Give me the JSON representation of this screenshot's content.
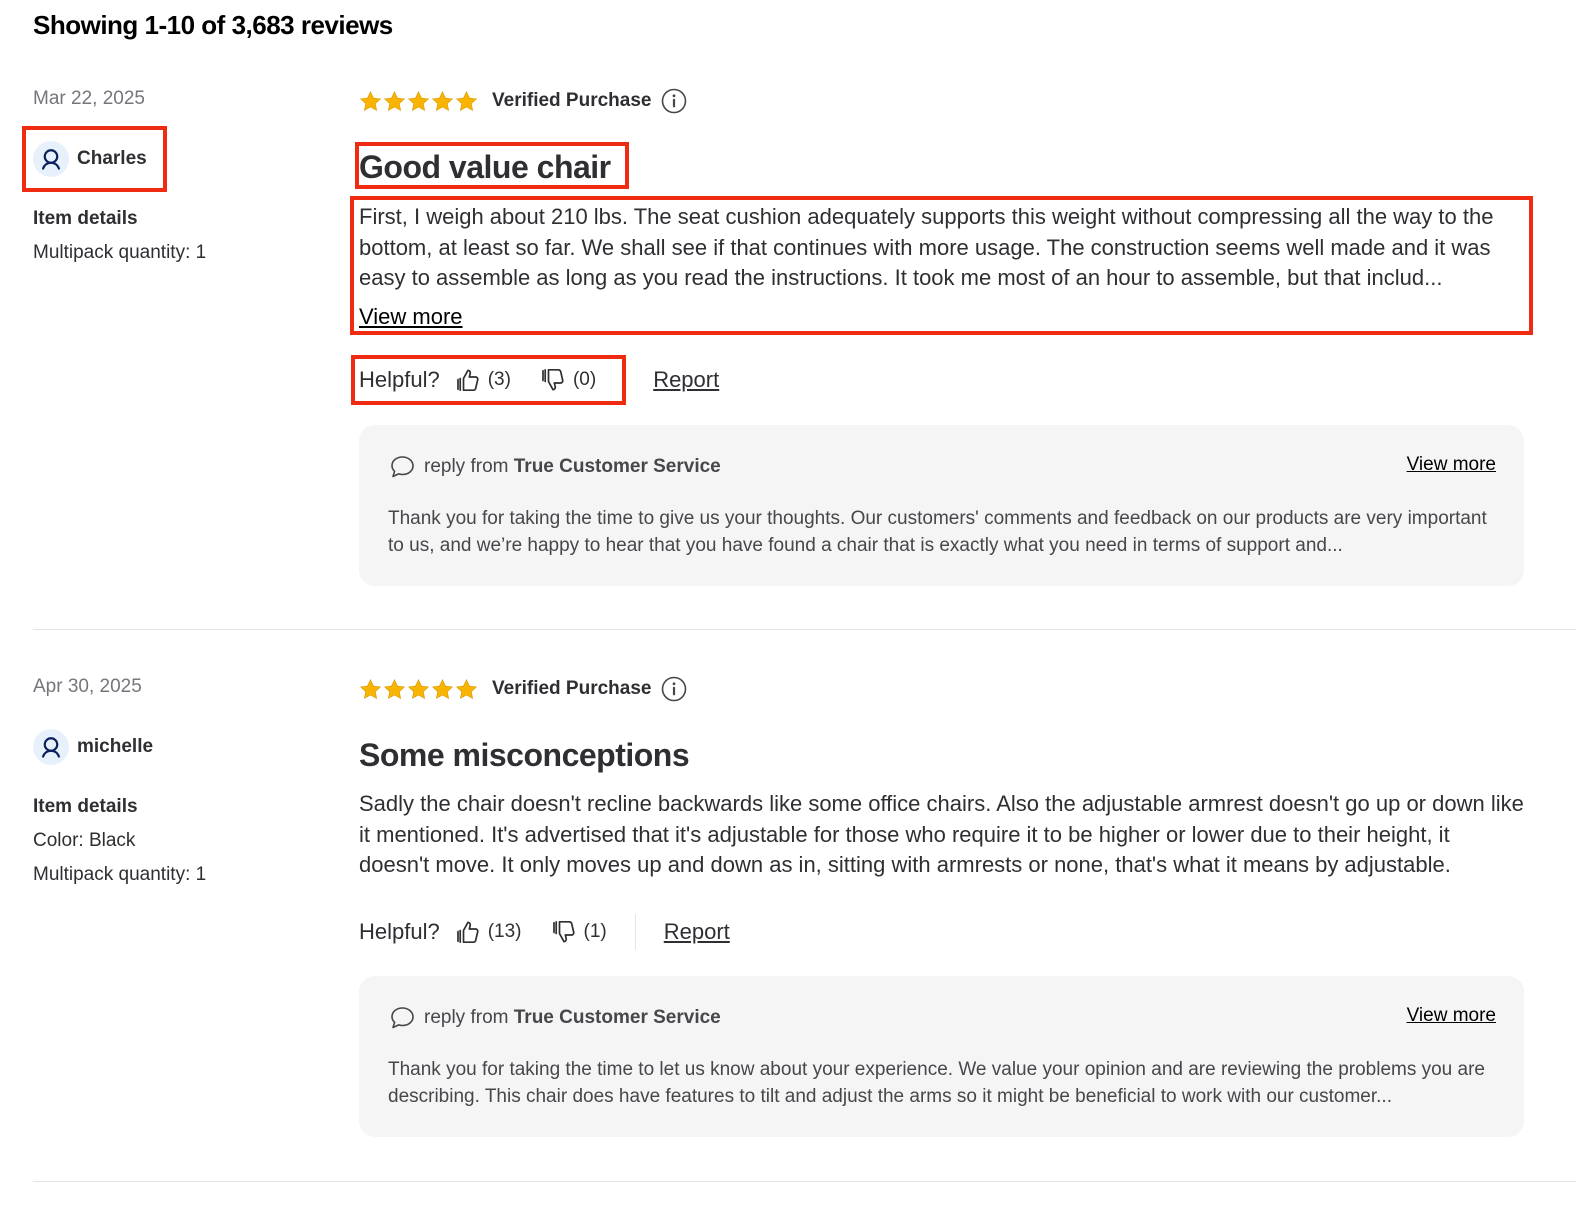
{
  "header": {
    "showing_text": "Showing 1-10 of 3,683 reviews"
  },
  "colors": {
    "star": "#f8b400",
    "highlight": "#ef2b12",
    "reply_bg": "#f5f5f6",
    "avatar_bg": "#e6f1fc",
    "avatar_icon": "#0d1f5c"
  },
  "labels": {
    "verified": "Verified Purchase",
    "item_details": "Item details",
    "helpful": "Helpful?",
    "report": "Report",
    "view_more": "View more",
    "reply_from": "reply from",
    "icons": [
      "star-icon",
      "info-icon",
      "user-icon",
      "thumbs-up-icon",
      "thumbs-down-icon",
      "comment-icon"
    ]
  },
  "reviews": [
    {
      "date": "Mar 22, 2025",
      "user": "Charles",
      "rating": 5,
      "details": [
        "Multipack quantity: 1"
      ],
      "title": "Good value chair",
      "body": "First, I weigh about 210 lbs. The seat cushion adequately supports this weight without compressing all the way to the bottom, at least so far. We shall see if that continues with more usage. The construction seems well made and it was easy to assemble as long as you read the instructions. It took me most of an hour to assemble, but that includ...",
      "helpful_up": "(3)",
      "helpful_down": "(0)",
      "reply": {
        "from": "True Customer Service",
        "text": "Thank you for taking the time to give us your thoughts. Our customers' comments and feedback on our products are very important to us, and we’re happy to hear that you have found a chair that is exactly what you need in terms of support and..."
      }
    },
    {
      "date": "Apr 30, 2025",
      "user": "michelle",
      "rating": 5,
      "details": [
        "Color: Black",
        "Multipack quantity: 1"
      ],
      "title": "Some misconceptions",
      "body": "Sadly the chair doesn't recline backwards like some office chairs. Also the adjustable armrest doesn't go up or down like it mentioned. It's advertised that it's adjustable for those who require it to be higher or lower due to their height, it doesn't move. It only moves up and down as in, sitting with armrests or none, that's what it means by adjustable.",
      "helpful_up": "(13)",
      "helpful_down": "(1)",
      "reply": {
        "from": "True Customer Service",
        "text": "Thank you for taking the time to let us know about your experience. We value your opinion and are reviewing the problems you are describing. This chair does have features to tilt and adjust the arms so it might be beneficial to work with our customer..."
      }
    }
  ]
}
